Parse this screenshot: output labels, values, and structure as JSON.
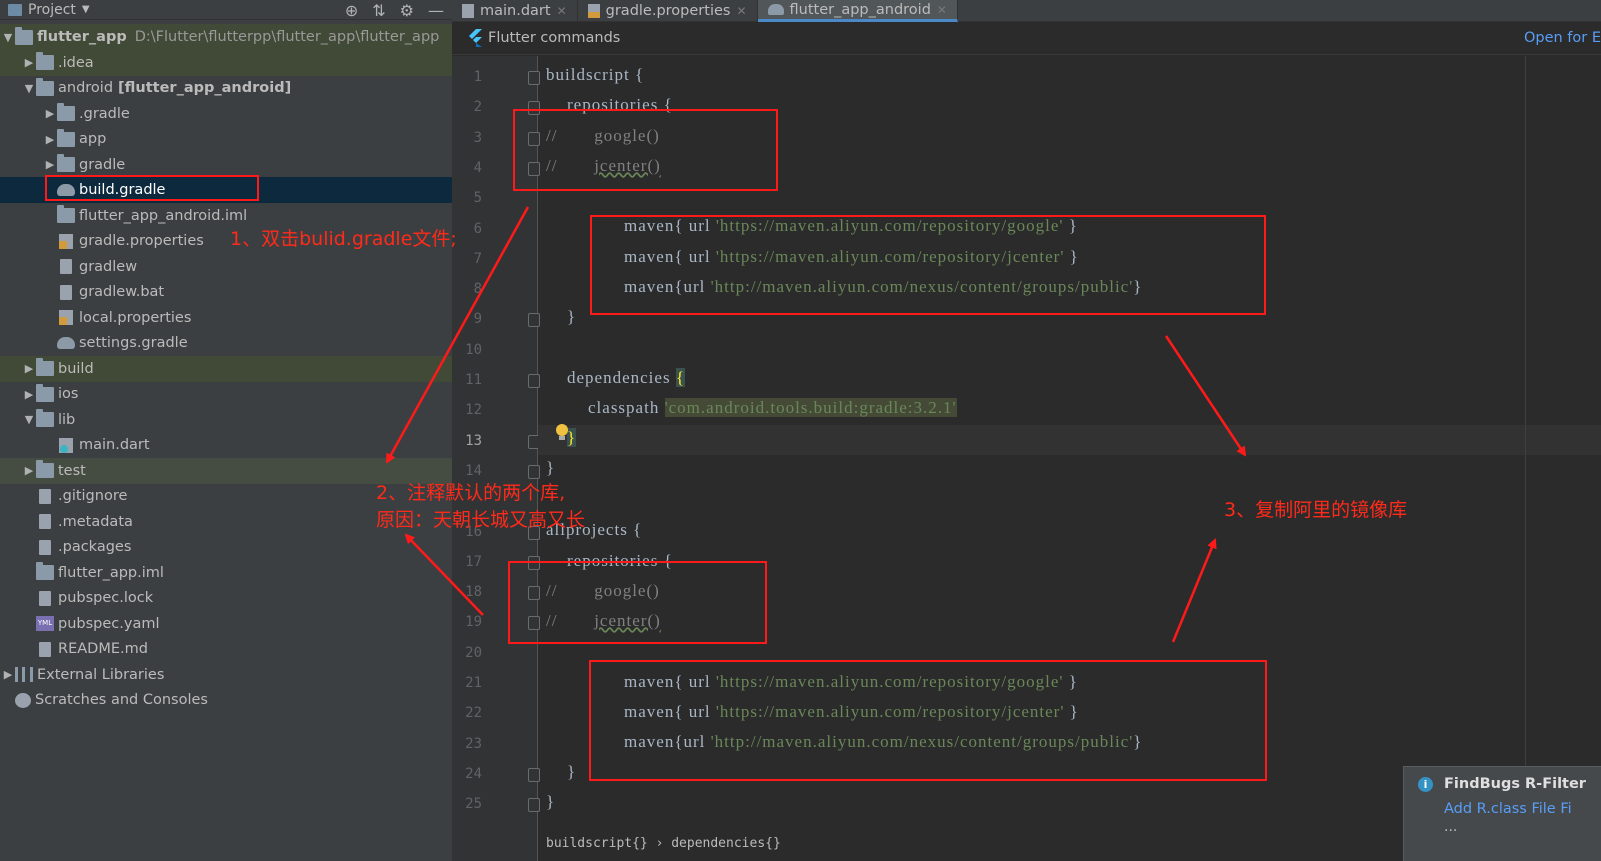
{
  "project_panel": {
    "title": "Project",
    "tree": [
      {
        "label": "flutter_app",
        "path": "D:\\Flutter\\flutterpp\\flutter_app\\flutter_app",
        "icon": "folder-icon",
        "arrow": "▼",
        "level": 0,
        "bold": true
      },
      {
        "label": ".idea",
        "icon": "folder-icon",
        "arrow": "▶",
        "level": 1
      },
      {
        "label": "android",
        "suffix": "[flutter_app_android]",
        "icon": "folder-icon",
        "arrow": "▼",
        "level": 1
      },
      {
        "label": ".gradle",
        "icon": "folder-icon",
        "arrow": "▶",
        "level": 2
      },
      {
        "label": "app",
        "icon": "folder-icon",
        "arrow": "▶",
        "level": 2
      },
      {
        "label": "gradle",
        "icon": "folder-icon",
        "arrow": "▶",
        "level": 2
      },
      {
        "label": "build.gradle",
        "icon": "gradle-icon",
        "arrow": "",
        "level": 2,
        "selected": true
      },
      {
        "label": "flutter_app_android.iml",
        "icon": "folder-icon",
        "arrow": "",
        "level": 2
      },
      {
        "label": "gradle.properties",
        "icon": "properties-icon",
        "arrow": "",
        "level": 2
      },
      {
        "label": "gradlew",
        "icon": "file-icon",
        "arrow": "",
        "level": 2
      },
      {
        "label": "gradlew.bat",
        "icon": "file-icon",
        "arrow": "",
        "level": 2
      },
      {
        "label": "local.properties",
        "icon": "properties-icon",
        "arrow": "",
        "level": 2
      },
      {
        "label": "settings.gradle",
        "icon": "gradle-icon",
        "arrow": "",
        "level": 2
      },
      {
        "label": "build",
        "icon": "folder-icon",
        "arrow": "▶",
        "level": 1
      },
      {
        "label": "ios",
        "icon": "folder-icon",
        "arrow": "▶",
        "level": 1
      },
      {
        "label": "lib",
        "icon": "folder-icon",
        "arrow": "▼",
        "level": 1
      },
      {
        "label": "main.dart",
        "icon": "dart-icon",
        "arrow": "",
        "level": 2
      },
      {
        "label": "test",
        "icon": "folder-icon",
        "arrow": "▶",
        "level": 1
      },
      {
        "label": ".gitignore",
        "icon": "file-icon",
        "arrow": "",
        "level": 1
      },
      {
        "label": ".metadata",
        "icon": "file-icon",
        "arrow": "",
        "level": 1
      },
      {
        "label": ".packages",
        "icon": "file-icon",
        "arrow": "",
        "level": 1
      },
      {
        "label": "flutter_app.iml",
        "icon": "folder-icon",
        "arrow": "",
        "level": 1
      },
      {
        "label": "pubspec.lock",
        "icon": "file-icon",
        "arrow": "",
        "level": 1
      },
      {
        "label": "pubspec.yaml",
        "icon": "yaml-icon",
        "arrow": "",
        "level": 1
      },
      {
        "label": "README.md",
        "icon": "file-icon",
        "arrow": "",
        "level": 1
      },
      {
        "label": "External Libraries",
        "icon": "library-icon",
        "arrow": "▶",
        "level": 0
      },
      {
        "label": "Scratches and Consoles",
        "icon": "scratch-icon",
        "arrow": "",
        "level": 0
      }
    ]
  },
  "tabs": [
    {
      "label": "main.dart",
      "active": false
    },
    {
      "label": "gradle.properties",
      "active": false
    },
    {
      "label": "flutter_app_android",
      "active": true
    }
  ],
  "banner": {
    "title": "Flutter commands",
    "link": "Open for E"
  },
  "line_numbers": [
    "1",
    "2",
    "3",
    "4",
    "5",
    "6",
    "7",
    "8",
    "9",
    "10",
    "11",
    "12",
    "13",
    "14",
    "",
    "16",
    "17",
    "18",
    "19",
    "20",
    "21",
    "22",
    "23",
    "24",
    "25"
  ],
  "current_line": "13",
  "code": {
    "l1": "buildscript {",
    "l2": "    repositories {",
    "l3_cmt": "//",
    "l3": "google()",
    "l4_cmt": "//",
    "l4": "jcenter()",
    "maven_kw": "maven{ url ",
    "maven_kw2": "maven{url ",
    "url_google": "'https://maven.aliyun.com/repository/google'",
    "url_jcenter": "'https://maven.aliyun.com/repository/jcenter'",
    "url_public": "'http://maven.aliyun.com/nexus/content/groups/public'",
    "close1": " }",
    "close2": "}",
    "l9": "    }",
    "l11": "    dependencies ",
    "lbrace": "{",
    "l12": "        classpath ",
    "l12_str": "'com.android.tools.build:gradle:3.2.1'",
    "l13": "    ",
    "rbrace": "}",
    "l14": "}",
    "l16": "allprojects {",
    "l17": "    repositories {",
    "l24": "    }",
    "l25": "}"
  },
  "annotations": {
    "a1": "1、双击bulid.gradle文件;",
    "a2_line1": "2、注释默认的两个库,",
    "a2_line2": "原因：天朝长城又高又长",
    "a3": "3、复制阿里的镜像库"
  },
  "notification": {
    "title": "FindBugs R-Filter",
    "link": "Add R.class File Fi",
    "more": "..."
  },
  "breadcrumb": "buildscript{} › dependencies{}",
  "colors": {
    "annotation_red": "#ff1a1a",
    "link_blue": "#589df6",
    "selection": "#0d293e"
  }
}
